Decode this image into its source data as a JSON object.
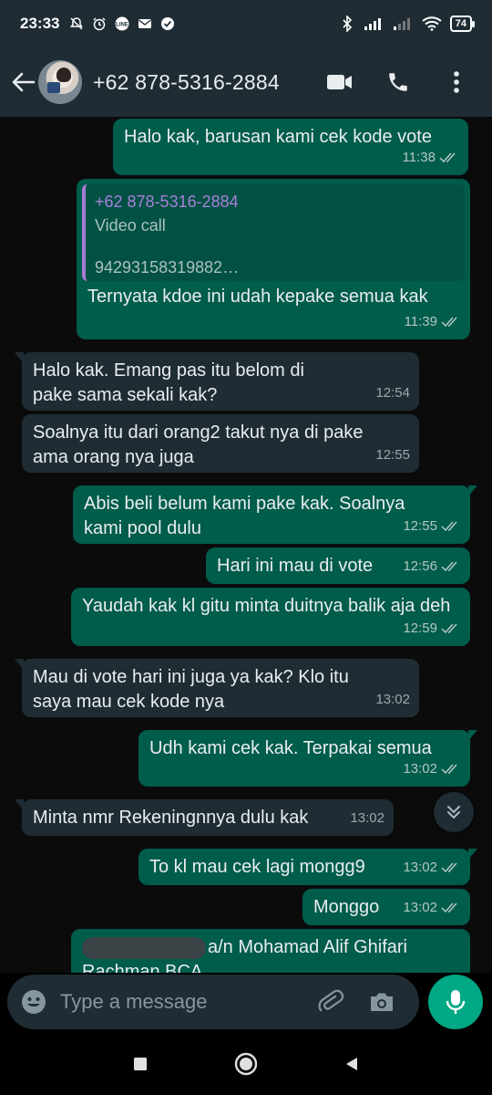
{
  "status_bar": {
    "time": "23:33",
    "battery": "74",
    "icons_left": [
      "bell-off-icon",
      "alarm-icon",
      "line-app-icon",
      "mail-icon",
      "check-circle-icon"
    ],
    "icons_right": [
      "bluetooth-icon",
      "signal-icon",
      "signal-2-icon",
      "wifi-icon",
      "battery-icon"
    ]
  },
  "header": {
    "contact_name": "+62 878-5316-2884",
    "actions": [
      "video-call-icon",
      "phone-icon",
      "more-options-icon"
    ]
  },
  "messages": [
    {
      "dir": "out",
      "text": "Halo kak, barusan kami cek kode vote",
      "time": "11:38",
      "ticks": true
    },
    {
      "dir": "out",
      "quote": {
        "name": "+62 878-5316-2884",
        "line1": "Video call",
        "line2": "94293158319882…"
      },
      "text": "Ternyata kdoe ini udah kepake semua kak",
      "time": "11:39",
      "ticks": true
    },
    {
      "dir": "in",
      "text": "Halo kak. Emang pas itu belom di pake sama sekali kak?",
      "time": "12:54"
    },
    {
      "dir": "in",
      "text": "Soalnya itu dari orang2 takut nya di pake ama orang nya juga",
      "time": "12:55"
    },
    {
      "dir": "out",
      "text": "Abis beli belum kami pake kak. Soalnya kami pool dulu",
      "time": "12:55",
      "ticks": true
    },
    {
      "dir": "out",
      "text": "Hari ini mau di vote",
      "time": "12:56",
      "ticks": true
    },
    {
      "dir": "out",
      "text": "Yaudah kak kl gitu minta duitnya balik aja deh",
      "time": "12:59",
      "ticks": true
    },
    {
      "dir": "in",
      "text": "Mau di vote hari ini juga ya kak? Klo itu saya mau cek kode nya",
      "time": "13:02"
    },
    {
      "dir": "out",
      "text": "Udh kami cek kak. Terpakai semua",
      "time": "13:02",
      "ticks": true
    },
    {
      "dir": "in",
      "text": "Minta nmr Rekeningnnya dulu kak",
      "time": "13:02"
    },
    {
      "dir": "out",
      "text": "To kl mau cek lagi mongg9",
      "time": "13:02",
      "ticks": true
    },
    {
      "dir": "out",
      "text": "Monggo",
      "time": "13:02",
      "ticks": true
    },
    {
      "dir": "out",
      "text": "a/n Mohamad Alif Ghifari Rachman BCA",
      "redacted": true
    }
  ],
  "composer": {
    "placeholder": "Type a message"
  },
  "colors": {
    "outgoing_bubble": "#005c4b",
    "incoming_bubble": "#1f2c34",
    "header_bg": "#1f2c34",
    "mic_button": "#00a884",
    "quote_accent": "#a67cd6"
  }
}
